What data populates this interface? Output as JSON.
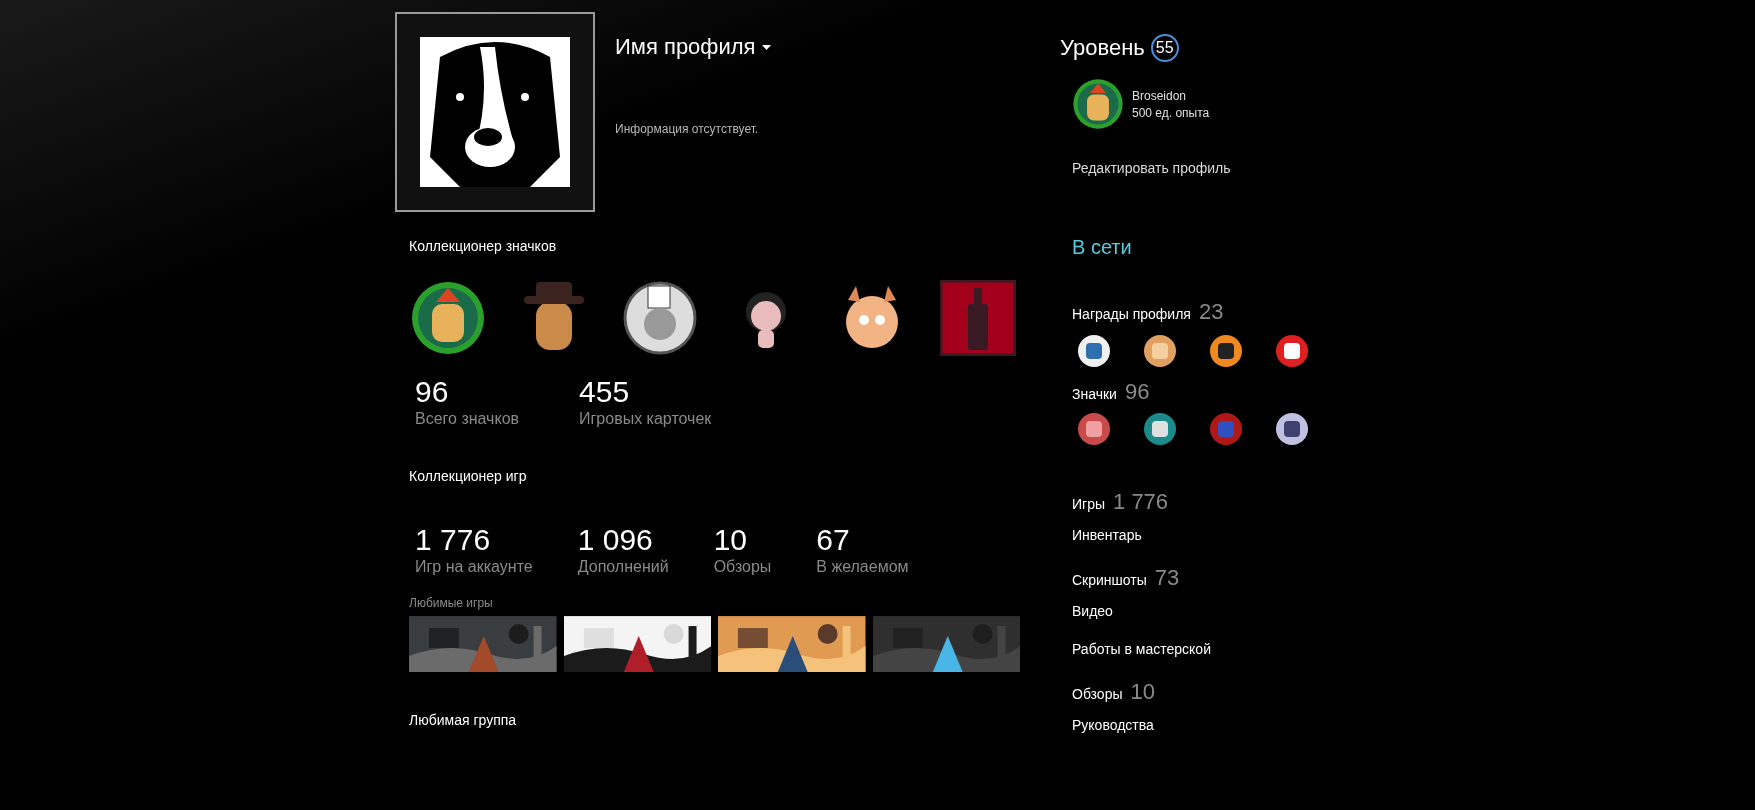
{
  "profile": {
    "name": "Имя профиля",
    "summary": "Информация отсутствует."
  },
  "badge_collector": {
    "title": "Коллекционер значков",
    "stats": [
      {
        "value": "96",
        "label": "Всего значков"
      },
      {
        "value": "455",
        "label": "Игровых карточек"
      }
    ]
  },
  "game_collector": {
    "title": "Коллекционер игр",
    "stats": [
      {
        "value": "1 776",
        "label": "Игр на аккаунте"
      },
      {
        "value": "1 096",
        "label": "Дополнений"
      },
      {
        "value": "10",
        "label": "Обзоры"
      },
      {
        "value": "67",
        "label": "В желаемом"
      }
    ],
    "favorite_games": {
      "label": "Любимые игры"
    }
  },
  "favorite_group": {
    "title": "Любимая группа"
  },
  "level": {
    "label": "Уровень",
    "value": "55"
  },
  "featured_badge": {
    "name": "Broseidon",
    "xp": "500 ед. опыта"
  },
  "edit_profile": "Редактировать профиль",
  "status": "В сети",
  "awards": {
    "label": "Награды профиля",
    "count": "23"
  },
  "badges": {
    "label": "Значки",
    "count": "96"
  },
  "links": [
    {
      "label": "Игры",
      "count": "1 776"
    },
    {
      "label": "Инвентарь"
    },
    {
      "label": "Скриншоты",
      "count": "73"
    },
    {
      "label": "Видео"
    },
    {
      "label": "Работы в мастерской"
    },
    {
      "label": "Обзоры",
      "count": "10"
    },
    {
      "label": "Руководства"
    }
  ]
}
